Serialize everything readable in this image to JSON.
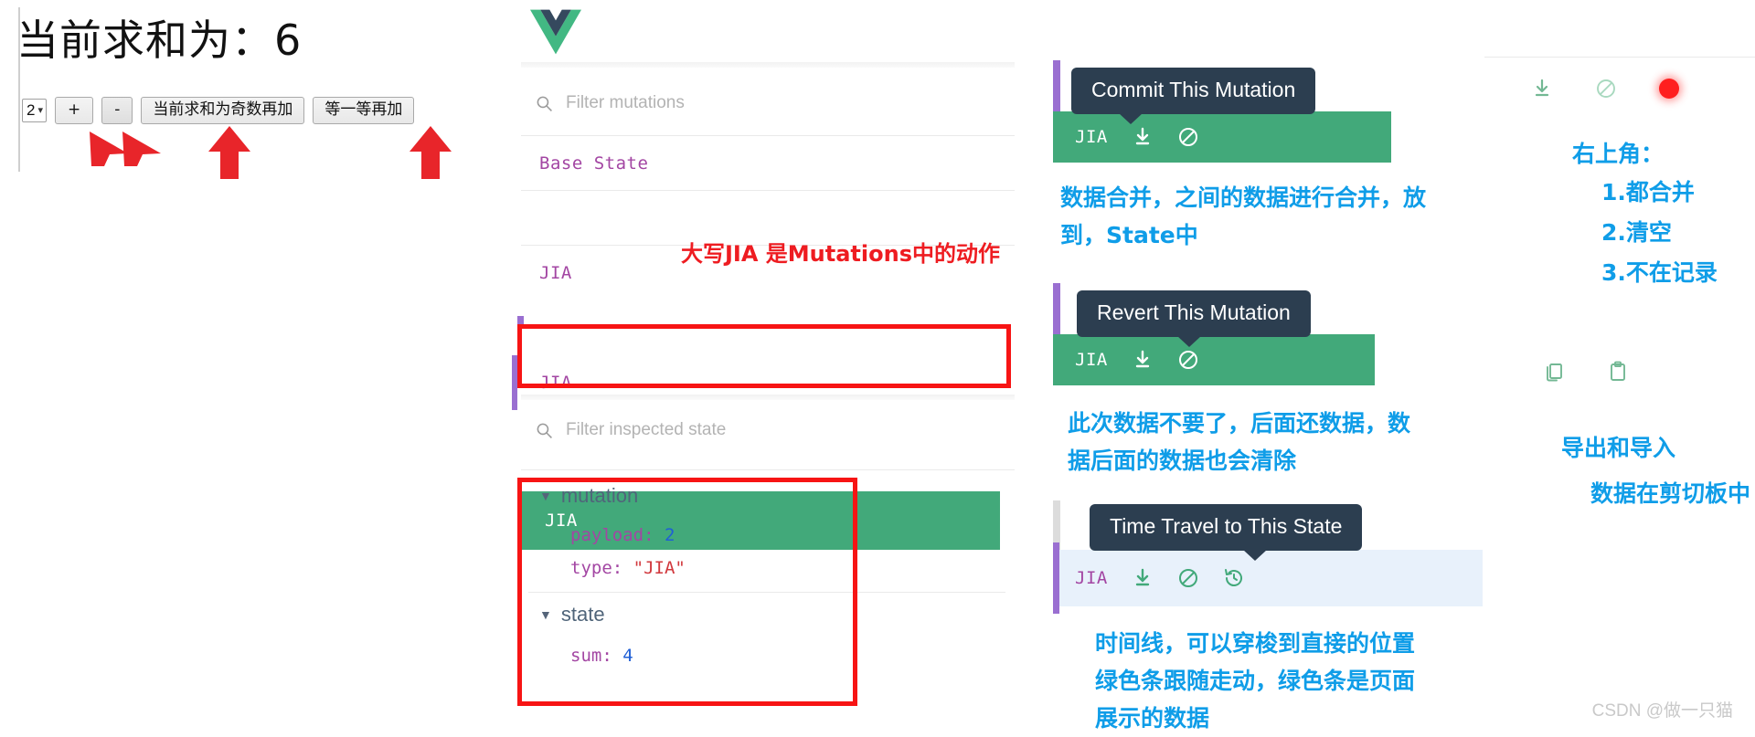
{
  "app": {
    "title": "当前求和为：6",
    "select_value": "2",
    "buttons": [
      {
        "name": "plus",
        "label": "+"
      },
      {
        "name": "minus",
        "label": "-"
      },
      {
        "name": "add-if-odd",
        "label": "当前求和为奇数再加"
      },
      {
        "name": "add-later",
        "label": "等一等再加"
      }
    ]
  },
  "devtools": {
    "logo": "vue-logo",
    "filter_mutations_placeholder": "Filter mutations",
    "filter_state_placeholder": "Filter inspected state",
    "mutations": [
      {
        "label": "Base State",
        "selected": false,
        "bar": false
      },
      {
        "label": "JIA",
        "selected": false,
        "bar": false
      },
      {
        "label": "JIA",
        "selected": false,
        "bar": true
      },
      {
        "label": "JIA",
        "selected": true,
        "bar": true
      }
    ],
    "inspected": {
      "mutation_key": "mutation",
      "payload_key": "payload:",
      "payload_value": "2",
      "type_key": "type:",
      "type_value": "\"JIA\"",
      "state_key": "state",
      "sum_key": "sum:",
      "sum_value": "4"
    }
  },
  "tooltips": [
    {
      "id": "commit",
      "label": "Commit This Mutation",
      "row_label": "JIA",
      "icons": [
        "download-icon",
        "revert-icon"
      ]
    },
    {
      "id": "revert",
      "label": "Revert This Mutation",
      "row_label": "JIA",
      "icons": [
        "download-icon",
        "revert-icon"
      ]
    },
    {
      "id": "timetravel",
      "label": "Time Travel to This State",
      "row_label": "JIA",
      "icons": [
        "download-icon",
        "revert-icon",
        "time-travel-icon"
      ]
    }
  ],
  "annotations": {
    "mutations_note": "大写JIA  是Mutations中的动作",
    "commit_note_line1": "数据合并，之间的数据进行合并，放",
    "commit_note_line2": "到，State中",
    "revert_note_line1": "此次数据不要了，后面还数据，数",
    "revert_note_line2": "据后面的数据也会清除",
    "timetravel_note_line1": "时间线，可以穿梭到直接的位置",
    "timetravel_note_line2": "绿色条跟随走动，绿色条是页面",
    "timetravel_note_line3": "展示的数据",
    "topright_title": "右上角：",
    "topright_1": "1.都合并",
    "topright_2": "2.清空",
    "topright_3": "3.不在记录",
    "export_title": "导出和导入",
    "export_sub": "数据在剪切板中"
  },
  "watermark": {
    "text": "CSDN @做一只猫"
  },
  "colors": {
    "green": "#42a97a",
    "purple_bar": "#9a6fd1",
    "tooltip_bg": "#2c3e50",
    "annotation_blue": "#0f9de8",
    "annotation_red": "#ee1c21",
    "highlight_red": "#f71414",
    "record_dot": "#ff1f1f"
  }
}
